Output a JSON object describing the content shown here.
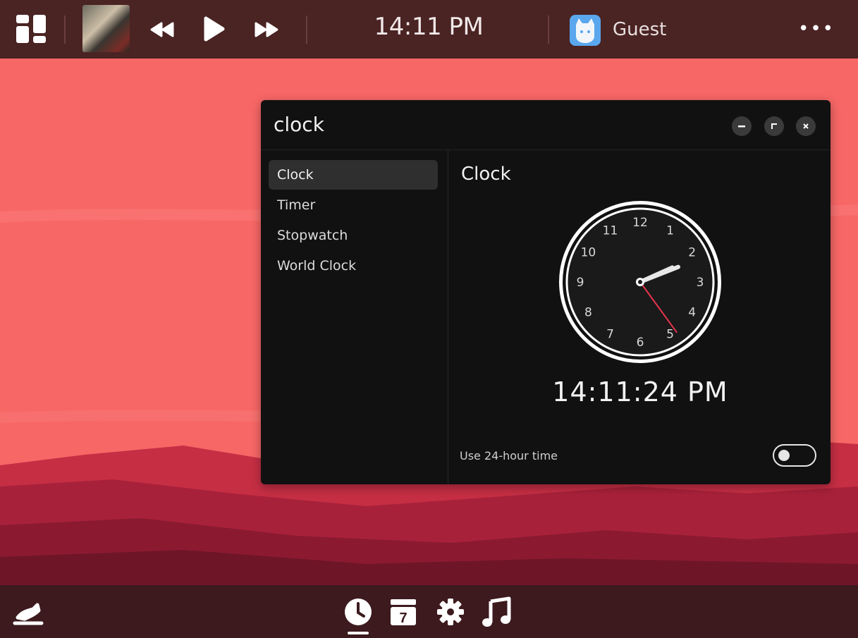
{
  "topbar": {
    "launcher_icon": "app-grid-icon",
    "media": {
      "album_art": "album-cover",
      "prev_icon": "rewind-icon",
      "play_icon": "play-icon",
      "next_icon": "fast-forward-icon"
    },
    "time": "14:11 PM",
    "user": {
      "avatar_icon": "cat-avatar-icon",
      "name": "Guest"
    },
    "more_label": "•••"
  },
  "window": {
    "title": "clock",
    "controls": [
      "minimize",
      "maximize",
      "close"
    ],
    "sidebar": {
      "items": [
        {
          "label": "Clock",
          "active": true
        },
        {
          "label": "Timer",
          "active": false
        },
        {
          "label": "Stopwatch",
          "active": false
        },
        {
          "label": "World Clock",
          "active": false
        }
      ]
    },
    "content": {
      "title": "Clock",
      "analog": {
        "numbers": [
          "12",
          "1",
          "2",
          "3",
          "4",
          "5",
          "6",
          "7",
          "8",
          "9",
          "10",
          "11"
        ],
        "hours": 14,
        "minutes": 11,
        "seconds": 24,
        "second_hand_color": "#e8344e"
      },
      "digital_time": "14:11:24 PM",
      "toggle_label": "Use 24-hour time",
      "toggle_on": false
    }
  },
  "dock": {
    "left_icon": "runner-icon",
    "apps": [
      "clock-icon",
      "calendar-icon",
      "settings-gear-icon",
      "music-note-icon"
    ],
    "calendar_day": "7",
    "active_app": "clock-icon"
  },
  "colors": {
    "wallpaper": "#f76766",
    "topbar": "#4a2323",
    "dock": "#3c1a1e",
    "window_bg": "#111111",
    "accent_second_hand": "#e8344e"
  }
}
